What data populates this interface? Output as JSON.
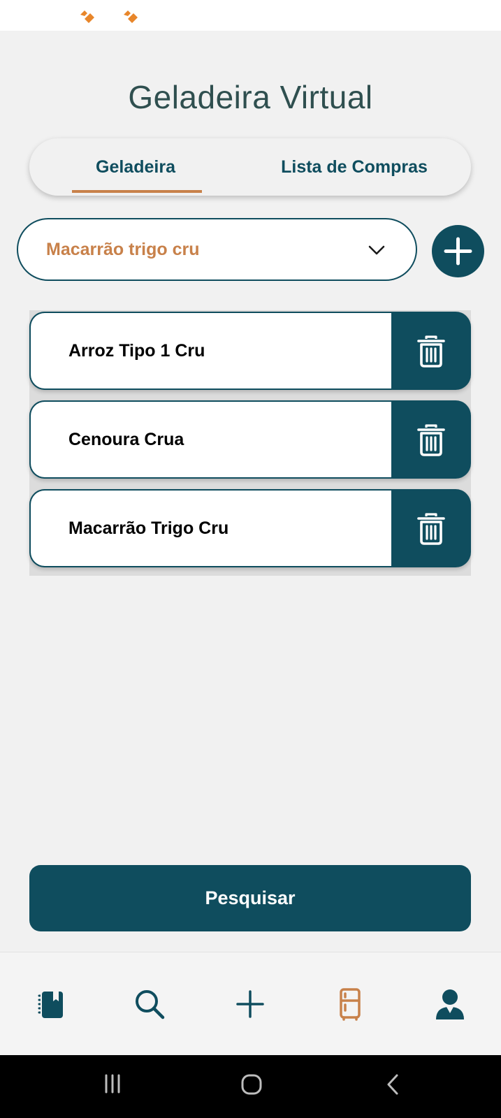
{
  "app": {
    "title": "Geladeira Virtual"
  },
  "colors": {
    "primary": "#0f4d5e",
    "accent": "#c8814a",
    "background": "#f1f1f1",
    "status_icon": "#e8862a"
  },
  "status_bar": {
    "icons": [
      "notification-app-icon",
      "notification-app-icon"
    ]
  },
  "tabs": [
    {
      "label": "Geladeira",
      "active": true
    },
    {
      "label": "Lista de Compras",
      "active": false
    }
  ],
  "ingredient_select": {
    "selected_value": "Macarrão trigo cru",
    "icon": "chevron-down-icon"
  },
  "add_button": {
    "icon": "plus-icon"
  },
  "items": [
    {
      "label": "Arroz Tipo 1 Cru",
      "action_icon": "trash-icon"
    },
    {
      "label": "Cenoura Crua",
      "action_icon": "trash-icon"
    },
    {
      "label": "Macarrão Trigo Cru",
      "action_icon": "trash-icon"
    }
  ],
  "search_button": {
    "label": "Pesquisar"
  },
  "bottom_nav": [
    {
      "icon": "recipe-book-icon",
      "active": false
    },
    {
      "icon": "search-icon",
      "active": false
    },
    {
      "icon": "plus-icon",
      "active": false
    },
    {
      "icon": "fridge-icon",
      "active": true
    },
    {
      "icon": "user-icon",
      "active": false
    }
  ],
  "system_nav": [
    {
      "icon": "recent-apps-icon"
    },
    {
      "icon": "home-icon"
    },
    {
      "icon": "back-icon"
    }
  ]
}
